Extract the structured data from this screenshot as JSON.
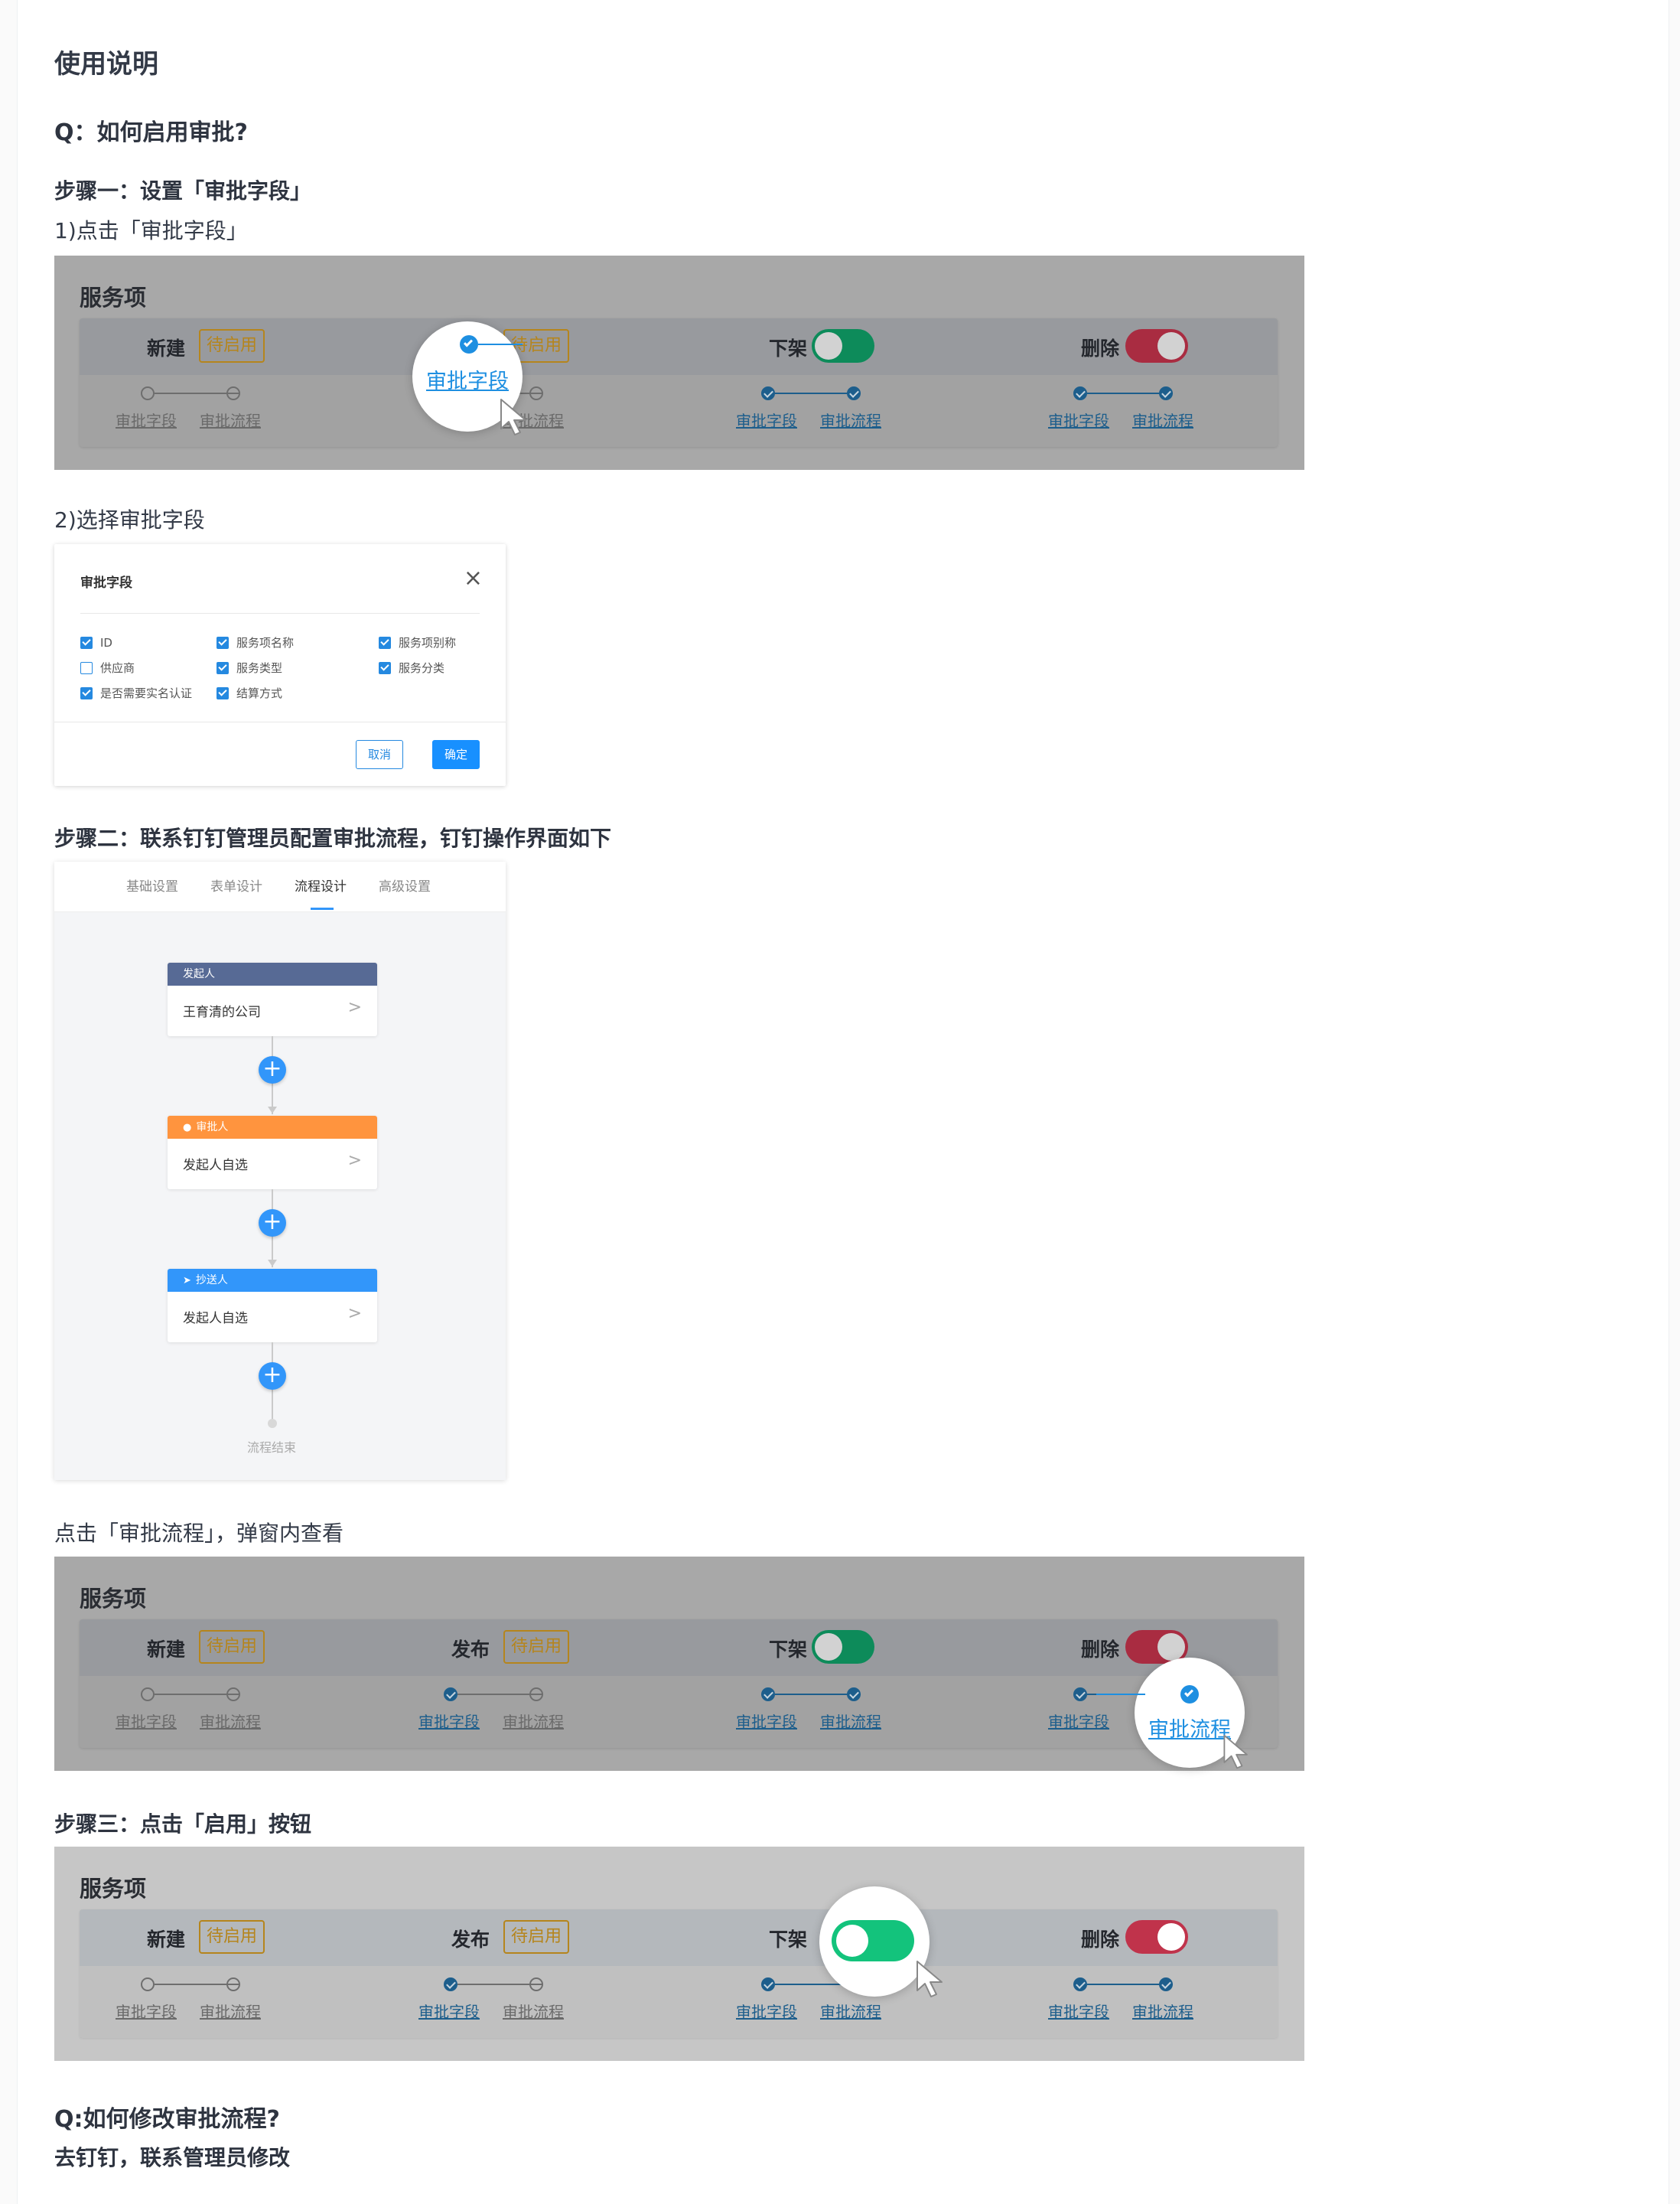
{
  "doc": {
    "title": "使用说明",
    "q1": "Q：如何启用审批?",
    "step1": "步骤一：设置「审批字段」",
    "step1_sub1": "1)点击「审批字段」",
    "step1_sub2": "2)选择审批字段",
    "step2": "步骤二：联系钉钉管理员配置审批流程，钉钉操作界面如下",
    "step2_sub": "点击「审批流程」，弹窗内查看",
    "step3": "步骤三：点击「启用」按钮",
    "q2": "Q:如何修改审批流程?",
    "a2": "去钉钉，联系管理员修改"
  },
  "panel": {
    "title": "服务项",
    "statuses": {
      "new": "新建",
      "publish": "发布",
      "offline": "下架",
      "delete": "删除"
    },
    "badge": "待启用",
    "step_field": "审批字段",
    "step_flow": "审批流程"
  },
  "dialog": {
    "title": "审批字段",
    "close": "×",
    "options": [
      {
        "label": "ID",
        "checked": true
      },
      {
        "label": "服务项名称",
        "checked": true
      },
      {
        "label": "服务项别称",
        "checked": true
      },
      {
        "label": "供应商",
        "checked": false
      },
      {
        "label": "服务类型",
        "checked": true
      },
      {
        "label": "服务分类",
        "checked": true
      },
      {
        "label": "是否需要实名认证",
        "checked": true
      },
      {
        "label": "结算方式",
        "checked": true
      }
    ],
    "cancel": "取消",
    "ok": "确定"
  },
  "dingtalk": {
    "tabs": [
      "基础设置",
      "表单设计",
      "流程设计",
      "高级设置"
    ],
    "active_tab": "流程设计",
    "nodes": [
      {
        "header": "发起人",
        "body": "王育清的公司",
        "color": "#576a95"
      },
      {
        "header": "审批人",
        "body": "发起人自选",
        "color": "#ff943e"
      },
      {
        "header": "抄送人",
        "body": "发起人自选",
        "color": "#3296fa"
      }
    ],
    "add": "+",
    "arrow": ">",
    "end": "流程结束"
  },
  "colors": {
    "link_blue": "#1e8fe1",
    "badge_orange": "#b5851d",
    "toggle_green": "#0d8b5a",
    "toggle_red": "#a92c41"
  }
}
